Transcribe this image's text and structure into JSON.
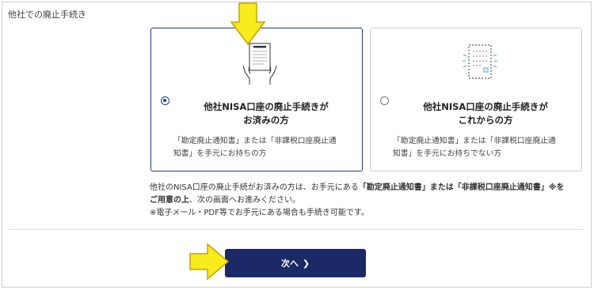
{
  "section": {
    "label": "他社での廃止手続き"
  },
  "options": [
    {
      "title_line1": "他社NISA口座の廃止手続きが",
      "title_line2": "お済みの方",
      "desc_line1": "「勘定廃止通知書」または「非課税口座廃止通",
      "desc_line2": "知書」を手元にお持ちの方",
      "selected": true,
      "illustration": "hands-holding-document-icon"
    },
    {
      "title_line1": "他社NISA口座の廃止手続きが",
      "title_line2": "これからの方",
      "desc_line1": "「勘定廃止通知書」または「非課税口座廃止通",
      "desc_line2": "知書」を手元にお持ちでない方",
      "selected": false,
      "illustration": "dashed-document-icon"
    }
  ],
  "notice": {
    "line1_pre": "他社のNISA口座の廃止手続がお済みの方は、お手元にある",
    "line1_bold": "「勘定廃止通知書」または「非課税口座廃止通知書」※を",
    "line2_bold": "ご用意の上",
    "line2_post": "、次の画面へお進みください。",
    "line3": "※電子メール・PDF等でお手元にある場合も手続き可能です。"
  },
  "next_button": {
    "label": "次へ",
    "chevron": "❯"
  },
  "colors": {
    "primary": "#1b2a66",
    "radio_selected": "#1f3f9a",
    "arrow_fill": "#f7ec1c",
    "arrow_stroke": "#c9a100",
    "icon_accent": "#4aa3df"
  }
}
